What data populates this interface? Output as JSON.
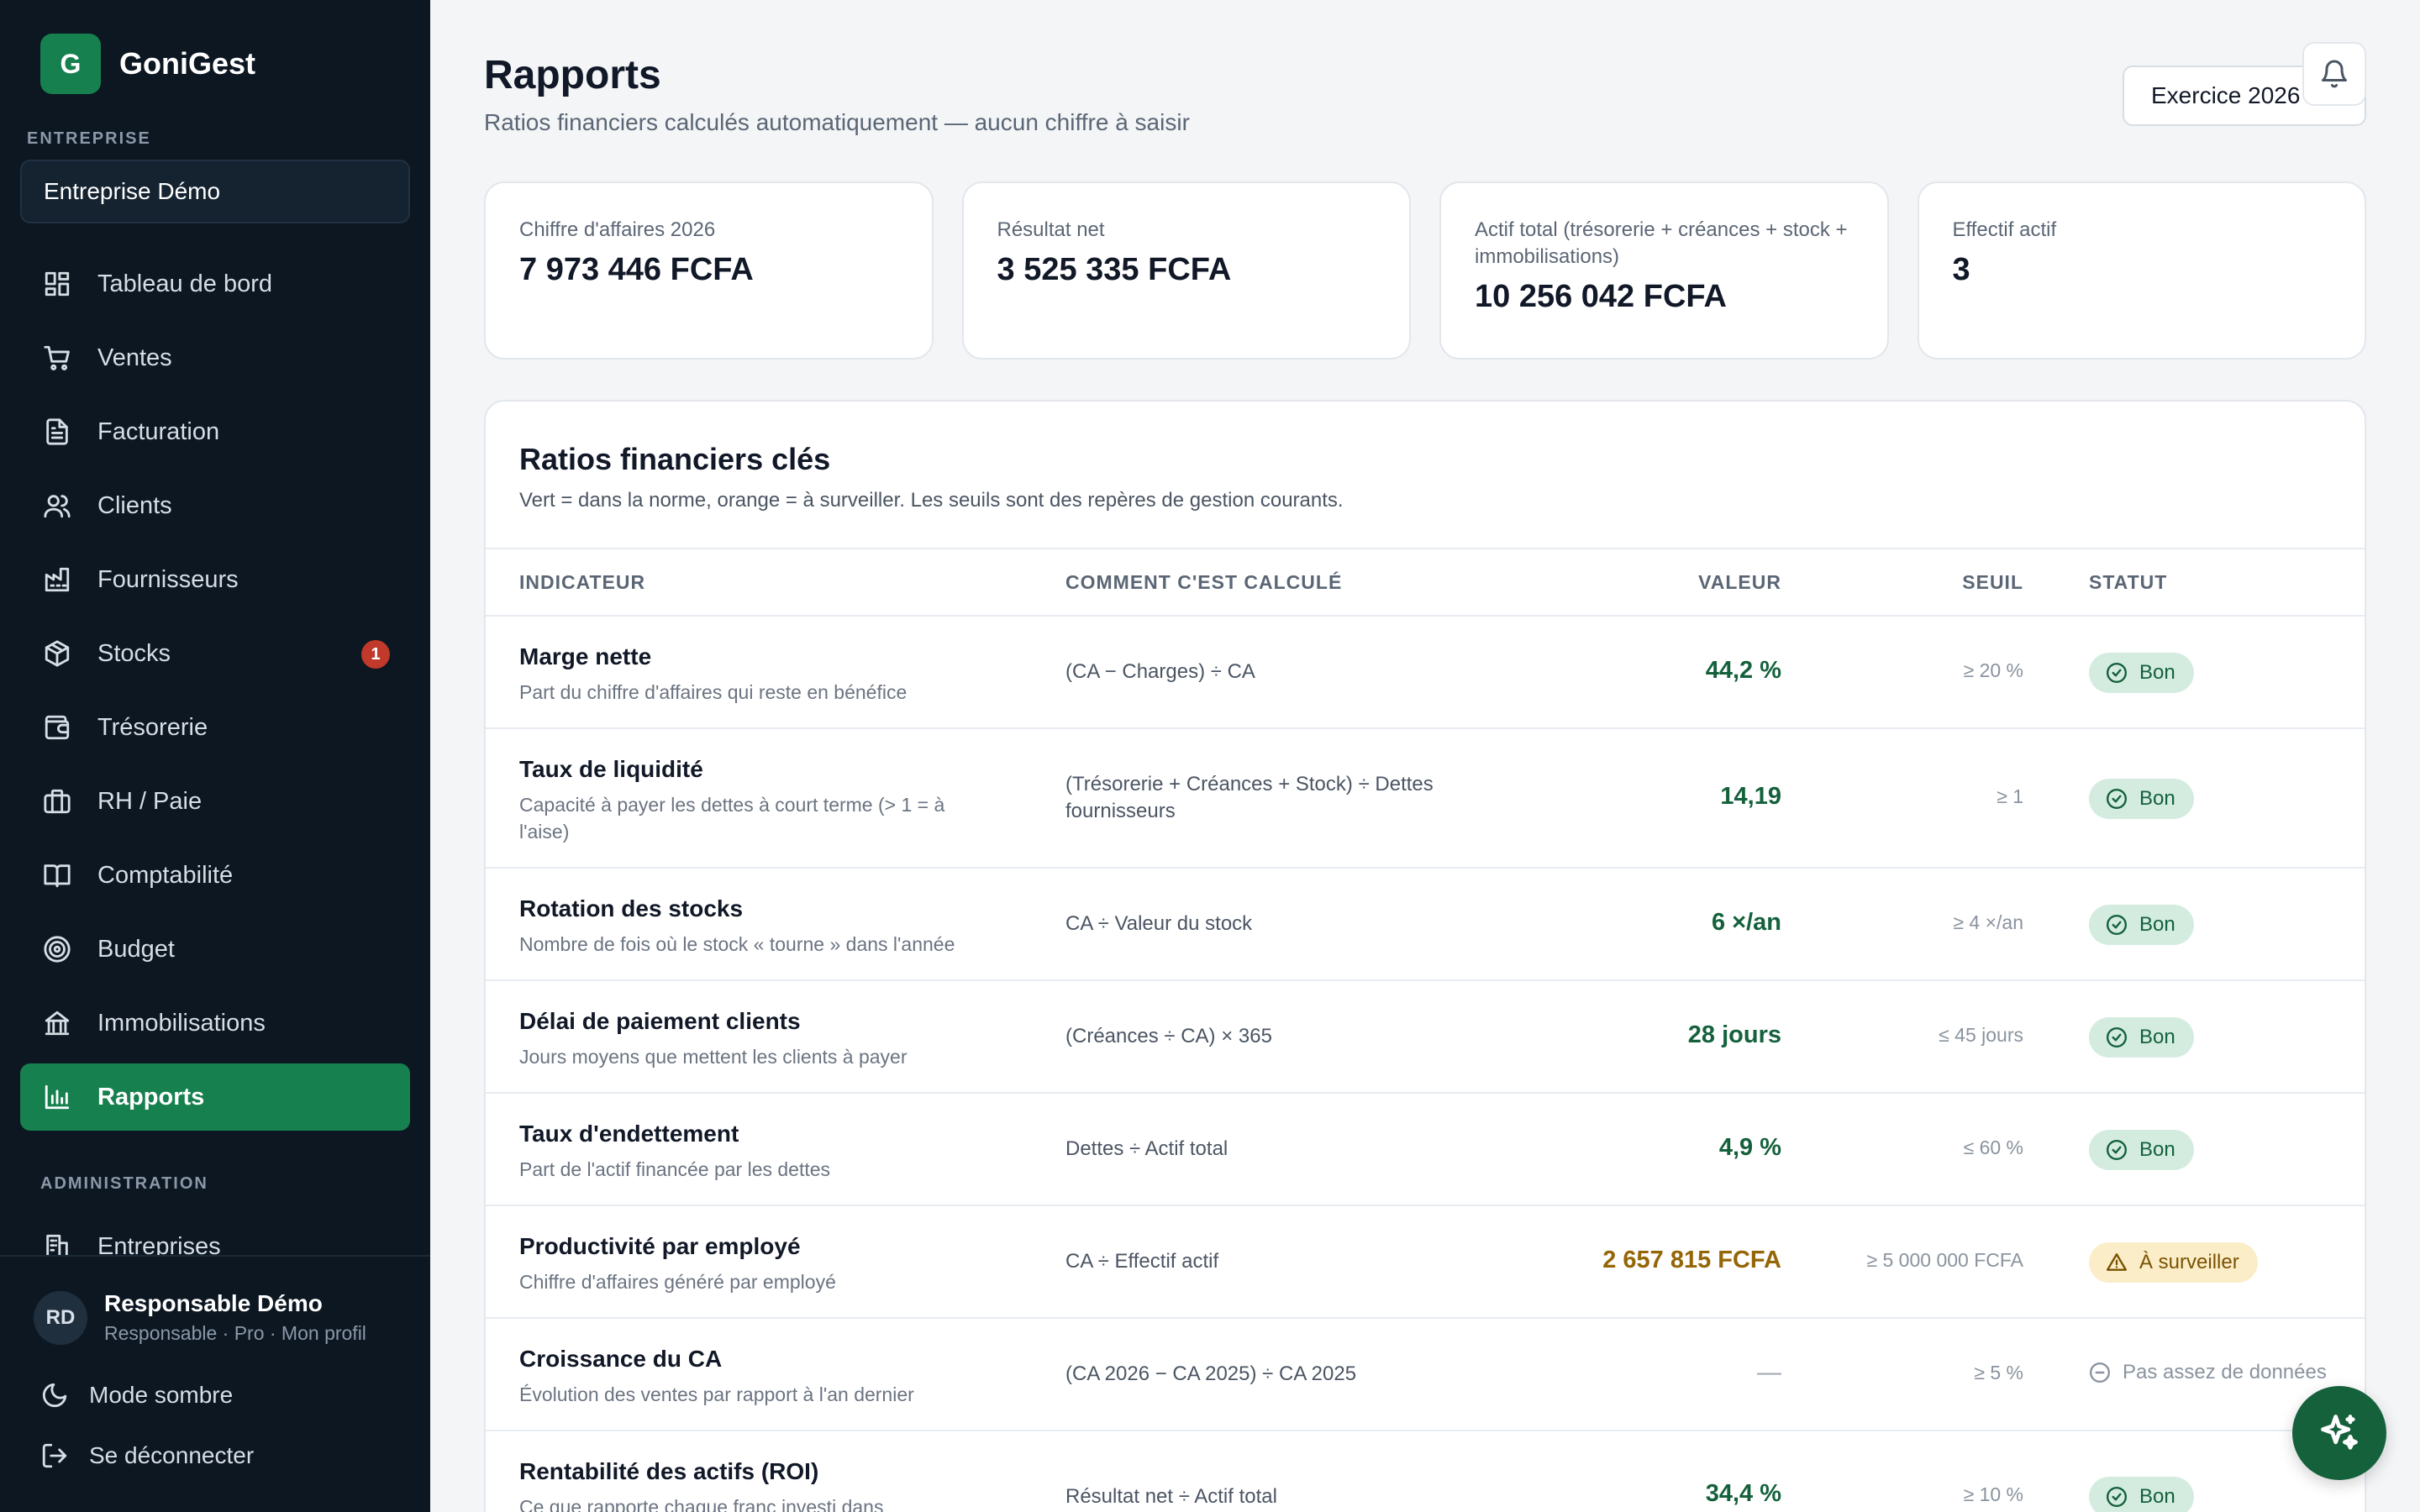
{
  "app": {
    "logo_letter": "G",
    "name": "GoniGest"
  },
  "sidebar": {
    "company_section": "ENTREPRISE",
    "company": "Entreprise Démo",
    "items": [
      {
        "label": "Tableau de bord",
        "icon": "dashboard-icon"
      },
      {
        "label": "Ventes",
        "icon": "cart-icon"
      },
      {
        "label": "Facturation",
        "icon": "invoice-icon"
      },
      {
        "label": "Clients",
        "icon": "users-icon"
      },
      {
        "label": "Fournisseurs",
        "icon": "factory-icon"
      },
      {
        "label": "Stocks",
        "icon": "box-icon",
        "badge": "1"
      },
      {
        "label": "Trésorerie",
        "icon": "wallet-icon"
      },
      {
        "label": "RH / Paie",
        "icon": "briefcase-icon"
      },
      {
        "label": "Comptabilité",
        "icon": "book-icon"
      },
      {
        "label": "Budget",
        "icon": "target-icon"
      },
      {
        "label": "Immobilisations",
        "icon": "bank-icon"
      },
      {
        "label": "Rapports",
        "icon": "chart-icon",
        "active": true
      }
    ],
    "admin_section": "ADMINISTRATION",
    "admin_items": [
      {
        "label": "Entreprises",
        "icon": "building-icon"
      }
    ],
    "user": {
      "initials": "RD",
      "name": "Responsable Démo",
      "subtitle": "Responsable · Pro · Mon profil"
    },
    "dark_mode": "Mode sombre",
    "logout": "Se déconnecter"
  },
  "header": {
    "title": "Rapports",
    "subtitle": "Ratios financiers calculés automatiquement — aucun chiffre à saisir",
    "year_button": "Exercice 2026"
  },
  "kpis": [
    {
      "label": "Chiffre d'affaires 2026",
      "value": "7 973 446 FCFA"
    },
    {
      "label": "Résultat net",
      "value": "3 525 335 FCFA"
    },
    {
      "label": "Actif total (trésorerie + créances + stock + immobilisations)",
      "value": "10 256 042 FCFA"
    },
    {
      "label": "Effectif actif",
      "value": "3"
    }
  ],
  "ratios": {
    "title": "Ratios financiers clés",
    "subtitle": "Vert = dans la norme, orange = à surveiller. Les seuils sont des repères de gestion courants.",
    "columns": [
      "Indicateur",
      "Comment c'est calculé",
      "Valeur",
      "Seuil",
      "Statut"
    ],
    "rows": [
      {
        "name": "Marge nette",
        "desc": "Part du chiffre d'affaires qui reste en bénéfice",
        "calc": "(CA − Charges) ÷ CA",
        "value": "44,2 %",
        "threshold": "≥ 20 %",
        "status": "Bon",
        "state": "good"
      },
      {
        "name": "Taux de liquidité",
        "desc": "Capacité à payer les dettes à court terme (> 1 = à l'aise)",
        "calc": "(Trésorerie + Créances + Stock) ÷ Dettes fournisseurs",
        "value": "14,19",
        "threshold": "≥ 1",
        "status": "Bon",
        "state": "good"
      },
      {
        "name": "Rotation des stocks",
        "desc": "Nombre de fois où le stock « tourne » dans l'année",
        "calc": "CA ÷ Valeur du stock",
        "value": "6 ×/an",
        "threshold": "≥ 4 ×/an",
        "status": "Bon",
        "state": "good"
      },
      {
        "name": "Délai de paiement clients",
        "desc": "Jours moyens que mettent les clients à payer",
        "calc": "(Créances ÷ CA) × 365",
        "value": "28 jours",
        "threshold": "≤ 45 jours",
        "status": "Bon",
        "state": "good"
      },
      {
        "name": "Taux d'endettement",
        "desc": "Part de l'actif financée par les dettes",
        "calc": "Dettes ÷ Actif total",
        "value": "4,9 %",
        "threshold": "≤ 60 %",
        "status": "Bon",
        "state": "good"
      },
      {
        "name": "Productivité par employé",
        "desc": "Chiffre d'affaires généré par employé",
        "calc": "CA ÷ Effectif actif",
        "value": "2 657 815 FCFA",
        "threshold": "≥ 5 000 000 FCFA",
        "status": "À surveiller",
        "state": "warn"
      },
      {
        "name": "Croissance du CA",
        "desc": "Évolution des ventes par rapport à l'an dernier",
        "calc": "(CA 2026 − CA 2025) ÷ CA 2025",
        "value": "—",
        "threshold": "≥ 5 %",
        "status": "Pas assez de données",
        "state": "none"
      },
      {
        "name": "Rentabilité des actifs (ROI)",
        "desc": "Ce que rapporte chaque franc investi dans",
        "calc": "Résultat net ÷ Actif total",
        "value": "34,4 %",
        "threshold": "≥ 10 %",
        "status": "Bon",
        "state": "good"
      }
    ]
  },
  "colors": {
    "sidebar_bg": "#0c1722",
    "accent": "#16804f",
    "good": "#14613c",
    "warn": "#946606",
    "badge": "#c0392b"
  }
}
